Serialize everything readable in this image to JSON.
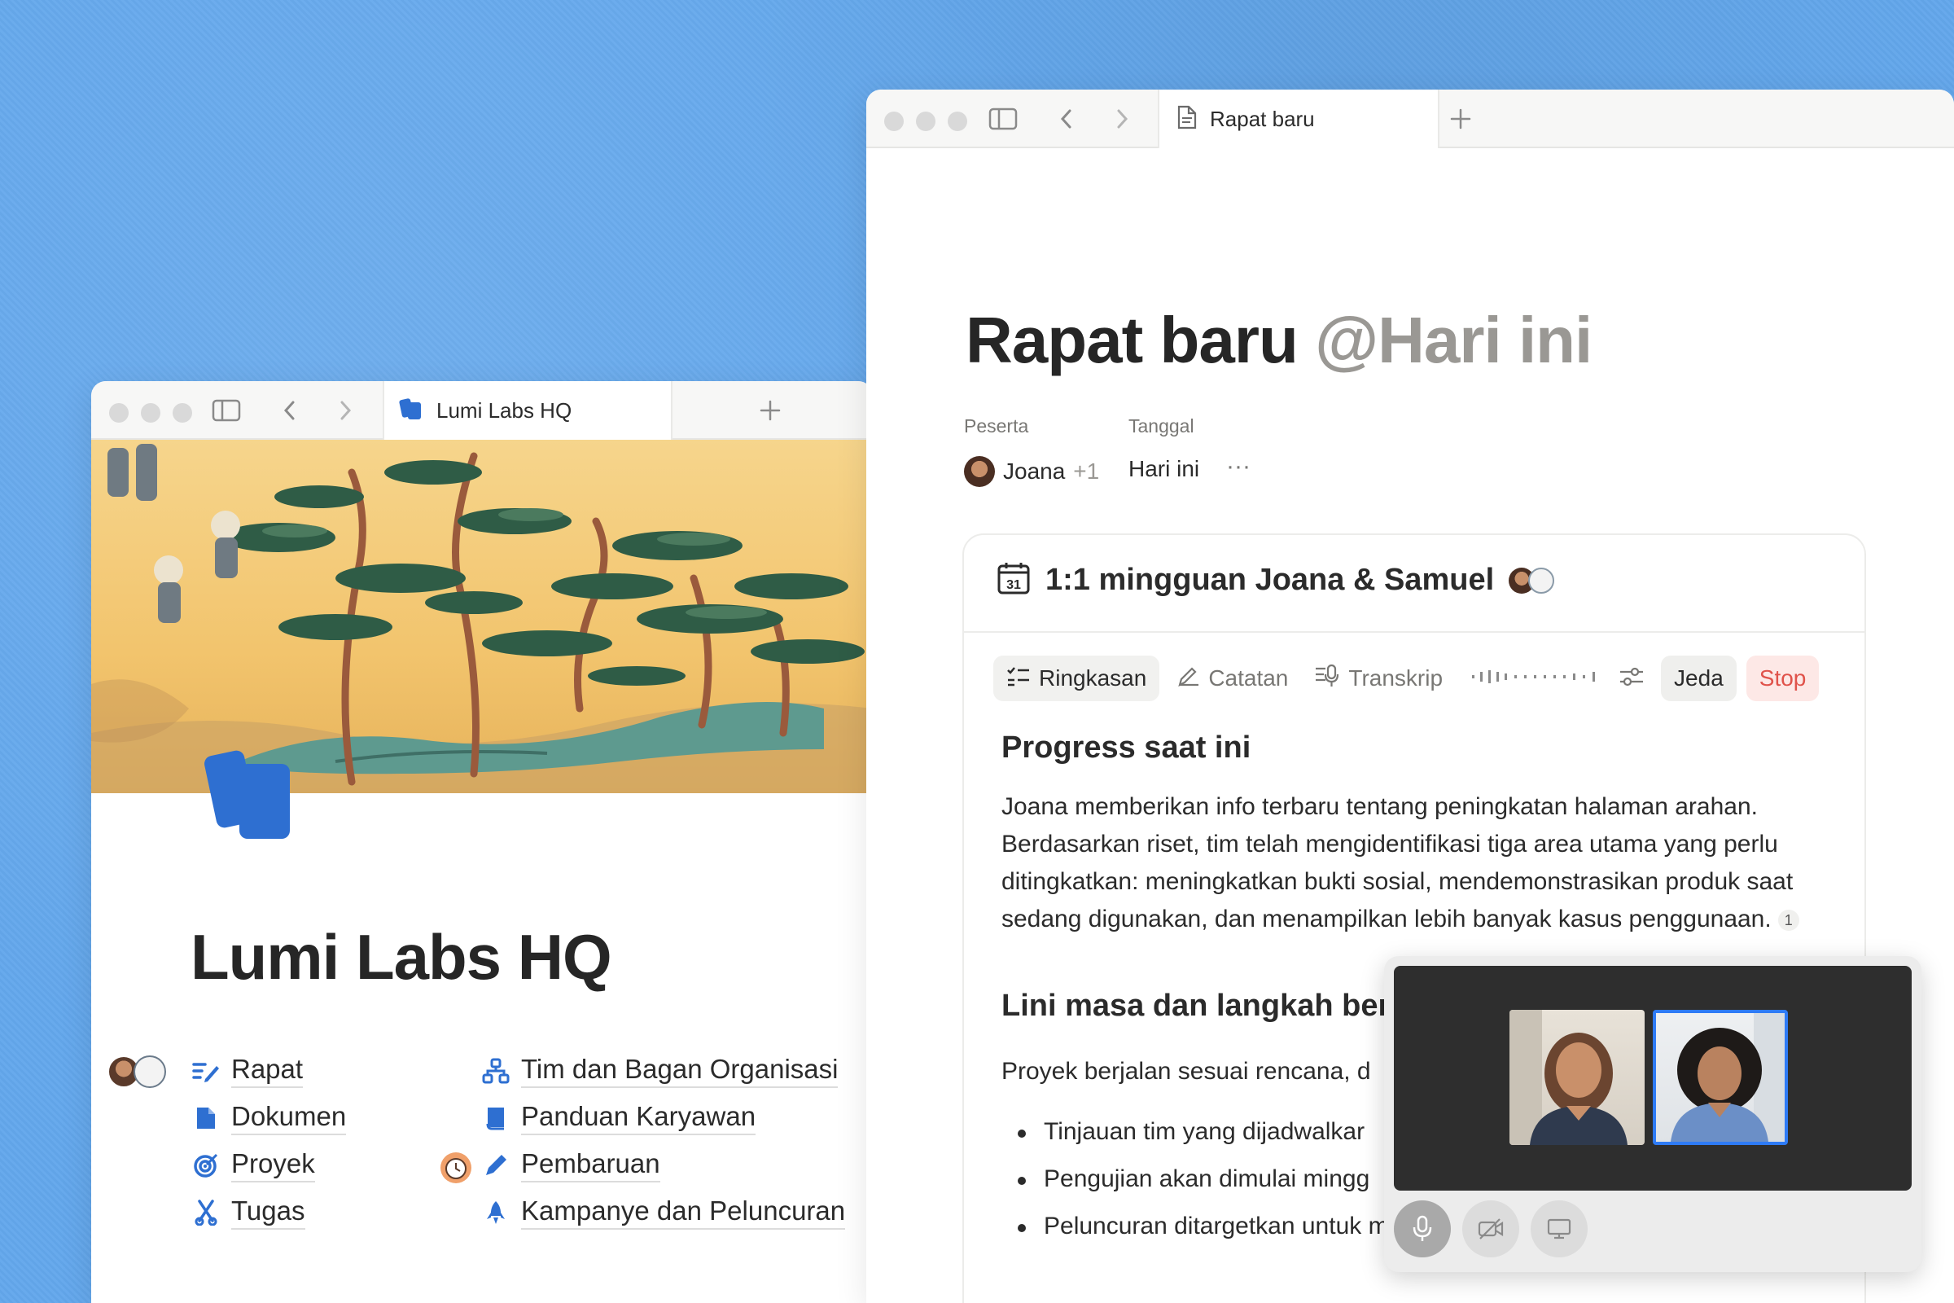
{
  "left_window": {
    "tab_title": "Lumi Labs HQ",
    "page_title": "Lumi Labs HQ",
    "links": [
      {
        "label": "Rapat",
        "icon": "meeting-notes-icon"
      },
      {
        "label": "Dokumen",
        "icon": "document-icon"
      },
      {
        "label": "Proyek",
        "icon": "target-icon"
      },
      {
        "label": "Tugas",
        "icon": "tasks-icon"
      },
      {
        "label": "Tim dan Bagan Organisasi",
        "icon": "org-chart-icon"
      },
      {
        "label": "Panduan Karyawan",
        "icon": "book-icon"
      },
      {
        "label": "Pembaruan",
        "icon": "pencil-icon"
      },
      {
        "label": "Kampanye dan Peluncuran",
        "icon": "rocket-icon"
      }
    ]
  },
  "right_window": {
    "tab_title": "Rapat baru",
    "title_main": "Rapat baru",
    "title_mention": "@Hari ini",
    "properties": {
      "participants_label": "Peserta",
      "participants_name": "Joana",
      "participants_extra": "+1",
      "date_label": "Tanggal",
      "date_value": "Hari ini",
      "more": "···"
    },
    "meeting": {
      "title": "1:1 mingguan Joana & Samuel",
      "calendar_day": "31",
      "tabs": {
        "summary": "Ringkasan",
        "notes": "Catatan",
        "transcript": "Transkrip"
      },
      "pause": "Jeda",
      "stop": "Stop",
      "heading1": "Progress saat ini",
      "paragraph1": "Joana memberikan info terbaru tentang peningkatan halaman arahan. Berdasarkan riset, tim telah mengidentifikasi tiga area utama yang perlu ditingkatkan: meningkatkan bukti sosial, mendemonstrasikan produk saat sedang digunakan, dan menampilkan lebih banyak kasus penggunaan.",
      "citation": "1",
      "heading2": "Lini masa dan langkah beri",
      "paragraph2": "Proyek berjalan sesuai rencana, d",
      "bullets": [
        "Tinjauan tim yang dijadwalkar",
        "Pengujian akan dimulai mingg",
        "Peluncuran ditargetkan untuk minggu setelah pengujian"
      ]
    }
  },
  "colors": {
    "background": "#63a7ec",
    "accent_blue": "#2e6fd1",
    "stop_red": "#e0524a",
    "speaking_border": "#2e7bf6"
  }
}
